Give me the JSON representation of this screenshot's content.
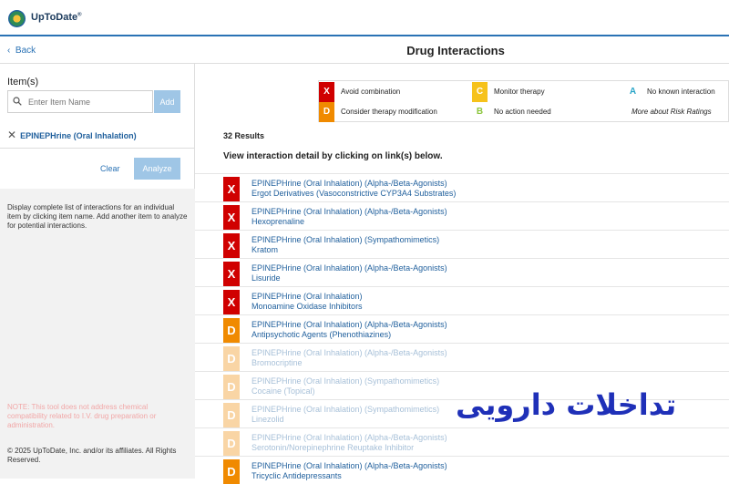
{
  "header": {
    "brand": "UpToDate",
    "brand_mark": "®"
  },
  "nav": {
    "back_label": "Back",
    "page_title": "Drug Interactions"
  },
  "sidebar": {
    "items_label": "Item(s)",
    "search_placeholder": "Enter Item Name",
    "add_label": "Add",
    "selected_item": "EPINEPHrine (Oral Inhalation)",
    "clear_label": "Clear",
    "analyze_label": "Analyze",
    "help_text": "Display complete list of interactions for an individual item by clicking item name. Add another item to analyze for potential interactions.",
    "note_text": "NOTE: This tool does not address chemical compatibility related to I.V. drug preparation or administration.",
    "copyright": "© 2025 UpToDate, Inc. and/or its affiliates. All Rights Reserved."
  },
  "legend": [
    {
      "code": "X",
      "label": "Avoid combination",
      "color": "#d00000"
    },
    {
      "code": "C",
      "label": "Monitor therapy",
      "color": "#f6c21b"
    },
    {
      "code": "A",
      "label": "No known interaction",
      "color": "#2aa5c8"
    },
    {
      "code": "D",
      "label": "Consider therapy modification",
      "color": "#f08a00"
    },
    {
      "code": "B",
      "label": "No action needed",
      "color": "#8cc63e"
    },
    {
      "code": "",
      "label": "More about Risk Ratings",
      "color": ""
    }
  ],
  "results": {
    "count_label": "32 Results",
    "instruction": "View interaction detail by clicking on link(s) below.",
    "rows": [
      {
        "risk": "X",
        "line1": "EPINEPHrine (Oral Inhalation) (Alpha-/Beta-Agonists)",
        "line2": "Ergot Derivatives (Vasoconstrictive CYP3A4 Substrates)"
      },
      {
        "risk": "X",
        "line1": "EPINEPHrine (Oral Inhalation) (Alpha-/Beta-Agonists)",
        "line2": "Hexoprenaline"
      },
      {
        "risk": "X",
        "line1": "EPINEPHrine (Oral Inhalation) (Sympathomimetics)",
        "line2": "Kratom"
      },
      {
        "risk": "X",
        "line1": "EPINEPHrine (Oral Inhalation) (Alpha-/Beta-Agonists)",
        "line2": "Lisuride"
      },
      {
        "risk": "X",
        "line1": "EPINEPHrine (Oral Inhalation)",
        "line2": "Monoamine Oxidase Inhibitors"
      },
      {
        "risk": "D",
        "line1": "EPINEPHrine (Oral Inhalation) (Alpha-/Beta-Agonists)",
        "line2": "Antipsychotic Agents (Phenothiazines)"
      },
      {
        "risk": "D",
        "line1": "EPINEPHrine (Oral Inhalation) (Alpha-/Beta-Agonists)",
        "line2": "Bromocriptine"
      },
      {
        "risk": "D",
        "line1": "EPINEPHrine (Oral Inhalation) (Sympathomimetics)",
        "line2": "Cocaine (Topical)"
      },
      {
        "risk": "D",
        "line1": "EPINEPHrine (Oral Inhalation) (Sympathomimetics)",
        "line2": "Linezolid"
      },
      {
        "risk": "D",
        "line1": "EPINEPHrine (Oral Inhalation) (Alpha-/Beta-Agonists)",
        "line2": "Serotonin/Norepinephrine Reuptake Inhibitor"
      },
      {
        "risk": "D",
        "line1": "EPINEPHrine (Oral Inhalation) (Alpha-/Beta-Agonists)",
        "line2": "Tricyclic Antidepressants"
      }
    ]
  },
  "overlay_text": "تداخلات دارویی",
  "colors": {
    "accent": "#2a72b5",
    "link": "#1f5f9c",
    "x": "#d00000",
    "d": "#f08a00"
  }
}
